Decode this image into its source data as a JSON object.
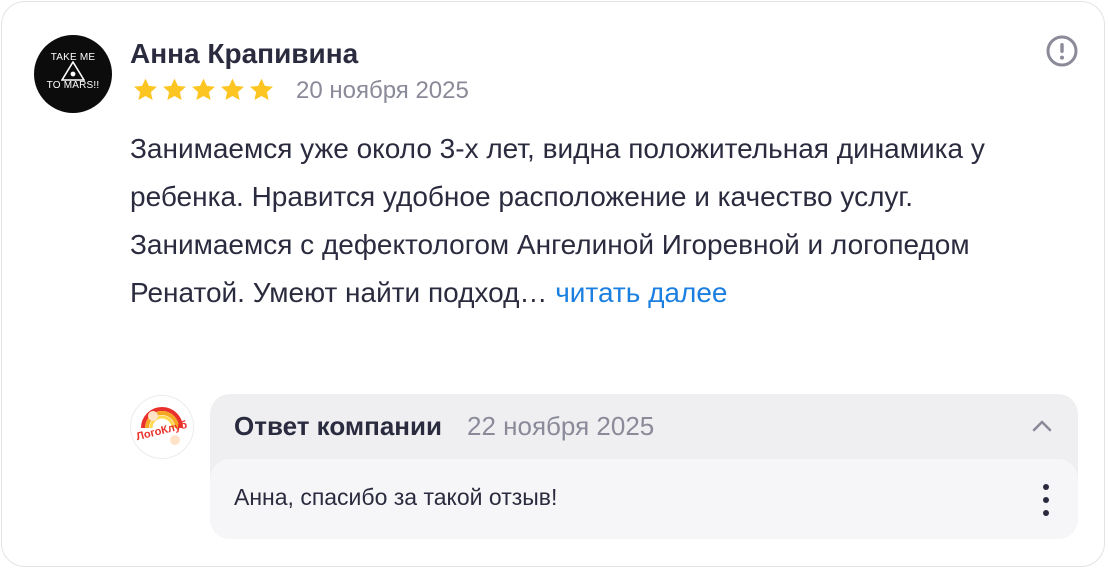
{
  "review": {
    "author": "Анна Крапивина",
    "avatar_text_top": "TAKE ME",
    "avatar_text_bottom": "TO MARS!!",
    "rating": 5,
    "date": "20 ноября 2025",
    "text_paragraph_1": "Занимаемся уже около 3-х лет, видна положительная динамика у ребенка. Нравится удобное расположение и качество услуг.",
    "text_paragraph_2": "Занимаемся с дефектологом Ангелиной Игоревной и логопедом Ренатой. Умеют найти подход…",
    "read_more_label": "читать далее",
    "report_icon": "exclamation-circle-icon"
  },
  "company_reply": {
    "logo_text": "ЛогоКлуб",
    "title": "Ответ компании",
    "date": "22 ноября 2025",
    "text": "Анна, спасибо за такой отзыв!",
    "collapse_icon": "chevron-up-icon",
    "menu_icon": "more-vertical-icon"
  },
  "colors": {
    "star": "#fcc521",
    "link": "#1a7fe0",
    "text": "#2b2b3f",
    "muted": "#8a8a99",
    "reply_bg": "#efeff2",
    "reply_body_bg": "#f6f6f8"
  }
}
